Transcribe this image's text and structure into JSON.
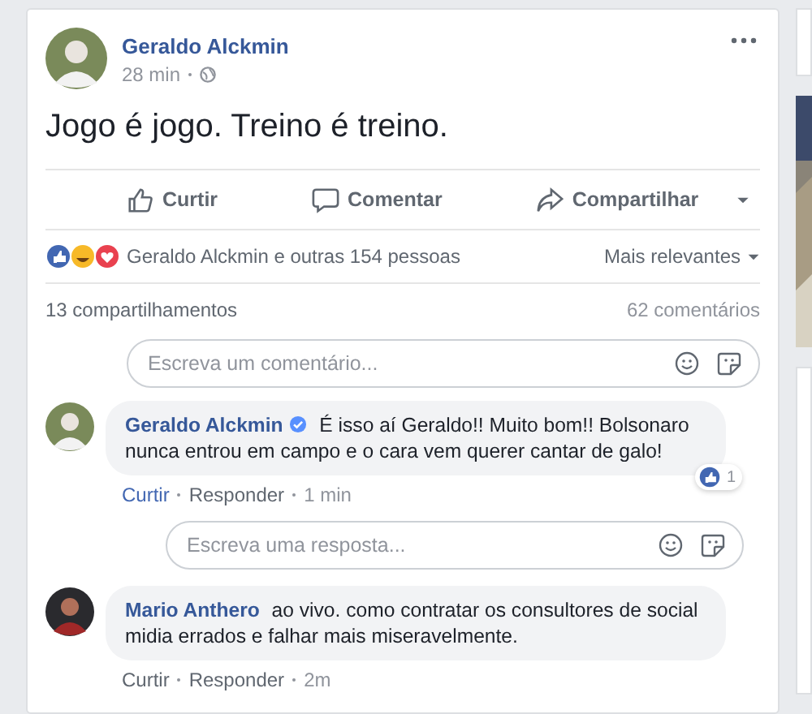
{
  "post": {
    "author": "Geraldo Alckmin",
    "time": "28 min",
    "text": "Jogo é jogo. Treino é treino.",
    "actions": [
      {
        "kind": "like",
        "label": "Curtir"
      },
      {
        "kind": "comment",
        "label": "Comentar"
      },
      {
        "kind": "share",
        "label": "Compartilhar"
      }
    ],
    "reactions_text": "Geraldo Alckmin e outras 154 pessoas",
    "sort": "Mais relevantes",
    "shares": "13 compartilhamentos",
    "comments_count": "62 comentários",
    "comment_box": {
      "placeholder": "Escreva um comentário..."
    },
    "comments": [
      {
        "author": "Geraldo Alckmin",
        "verified": true,
        "text": "É isso aí Geraldo!! Muito bom!! Bolsonaro nunca entrou em campo e o cara vem querer cantar de galo!",
        "like": "Curtir",
        "liked": true,
        "reply": "Responder",
        "time": "1 min",
        "reaction_count": "1",
        "reply_box": {
          "placeholder": "Escreva uma resposta..."
        }
      },
      {
        "author": "Mario Anthero",
        "verified": false,
        "text": "ao vivo. como contratar os consultores de social midia errados e falhar mais miseravelmente.",
        "like": "Curtir",
        "liked": false,
        "reply": "Responder",
        "time": "2m"
      }
    ]
  }
}
